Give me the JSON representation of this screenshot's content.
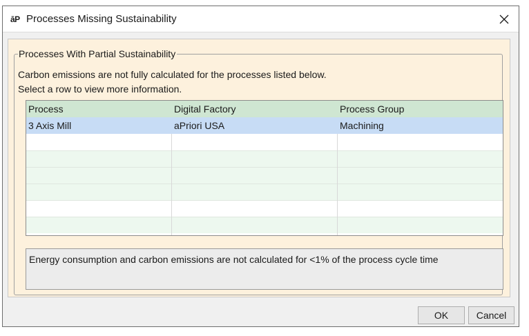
{
  "window": {
    "app_logo": "āP",
    "title": "Processes Missing Sustainability",
    "close_icon": "close-icon"
  },
  "group": {
    "legend": "Processes With Partial Sustainability",
    "description_line1": "Carbon emissions are not fully calculated for the processes listed below.",
    "description_line2": "Select a row to view more information."
  },
  "table": {
    "columns": [
      "Process",
      "Digital Factory",
      "Process Group"
    ],
    "rows": [
      {
        "process": "3 Axis Mill",
        "digital_factory": "aPriori USA",
        "process_group": "Machining",
        "selected": true
      }
    ]
  },
  "info": {
    "message": "Energy consumption and carbon emissions are not calculated for <1% of the process cycle time"
  },
  "buttons": {
    "ok": "OK",
    "cancel": "Cancel"
  },
  "colors": {
    "header_bg": "#cfe6d2",
    "selected_row": "#c7dcf5",
    "panel_bg": "#fdf1dd"
  }
}
